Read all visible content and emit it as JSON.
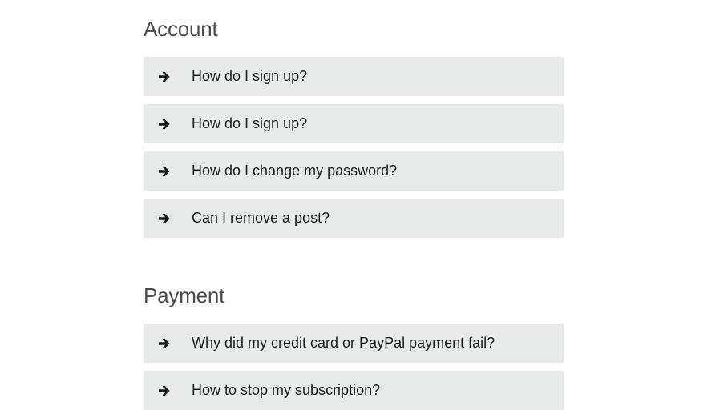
{
  "sections": [
    {
      "title": "Account",
      "items": [
        {
          "question": "How do I sign up?",
          "icon": "arrow-right-icon"
        },
        {
          "question": "How do I sign up?",
          "icon": "arrow-right-icon"
        },
        {
          "question": "How do I change my password?",
          "icon": "arrow-right-icon"
        },
        {
          "question": "Can I remove a post?",
          "icon": "arrow-right-icon"
        }
      ]
    },
    {
      "title": "Payment",
      "items": [
        {
          "question": "Why did my credit card or PayPal payment fail?",
          "icon": "arrow-right-icon"
        },
        {
          "question": "How to stop my subscription?",
          "icon": "arrow-right-icon"
        }
      ]
    }
  ],
  "colors": {
    "item_background": "#e8e9e9",
    "heading_text": "#4a4a4a",
    "question_text": "#1f1f1f",
    "page_background": "#ffffff"
  }
}
